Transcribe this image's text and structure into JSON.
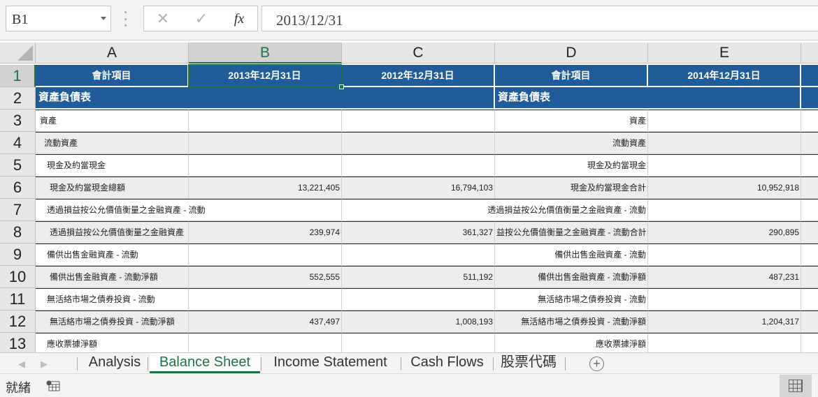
{
  "formula_bar": {
    "name_box": "B1",
    "cancel_icon": "✕",
    "enter_icon": "✓",
    "fx_label": "fx",
    "formula_value": "2013/12/31"
  },
  "columns": [
    "A",
    "B",
    "C",
    "D",
    "E"
  ],
  "rows": [
    "1",
    "2",
    "3",
    "4",
    "5",
    "6",
    "7",
    "8",
    "9",
    "10",
    "11",
    "12",
    "13"
  ],
  "header_row": {
    "a": "會計項目",
    "b": "2013年12月31日",
    "c": "2012年12月31日",
    "d": "會計項目",
    "e": "2014年12月31日"
  },
  "section_row": {
    "a": "資產負債表",
    "d": "資產負債表"
  },
  "data_rows": [
    {
      "a": "資產",
      "b": "",
      "c": "",
      "d": "資產",
      "e": ""
    },
    {
      "a": "流動資產",
      "b": "",
      "c": "",
      "d": "流動資產",
      "e": ""
    },
    {
      "a": "現金及約當現金",
      "b": "",
      "c": "",
      "d": "現金及約當現金",
      "e": ""
    },
    {
      "a": "現金及約當現金總額",
      "b": "13,221,405",
      "c": "16,794,103",
      "d": "現金及約當現金合計",
      "e": "10,952,918"
    },
    {
      "a": "透過損益按公允價值衡量之金融資產 - 流動",
      "b": "",
      "c": "",
      "d": "透過損益按公允價值衡量之金融資產 - 流動",
      "e": ""
    },
    {
      "a": "透過損益按公允價值衡量之金融資產",
      "b": "239,974",
      "c": "361,327",
      "d": "益按公允價值衡量之金融資產 - 流動合計",
      "e": "290,895"
    },
    {
      "a": "備供出售金融資產 - 流動",
      "b": "",
      "c": "",
      "d": "備供出售金融資產 - 流動",
      "e": ""
    },
    {
      "a": "備供出售金融資產 - 流動淨額",
      "b": "552,555",
      "c": "511,192",
      "d": "備供出售金融資產 - 流動淨額",
      "e": "487,231"
    },
    {
      "a": "無活絡市場之債券投資 - 流動",
      "b": "",
      "c": "",
      "d": "無活絡市場之債券投資 - 流動",
      "e": ""
    },
    {
      "a": "無活絡市場之債券投資 - 流動淨額",
      "b": "437,497",
      "c": "1,008,193",
      "d": "無活絡市場之債券投資 - 流動淨額",
      "e": "1,204,317"
    },
    {
      "a": "應收票據淨額",
      "b": "",
      "c": "",
      "d": "應收票據淨額",
      "e": ""
    }
  ],
  "sheet_tabs": [
    "Analysis",
    "Balance Sheet",
    "Income Statement",
    "Cash Flows",
    "股票代碼"
  ],
  "active_tab": "Balance Sheet",
  "status": {
    "ready_text": "就緒"
  },
  "colors": {
    "accent": "#217346",
    "header_fill": "#1f5c99",
    "band_fill": "#ececec"
  }
}
